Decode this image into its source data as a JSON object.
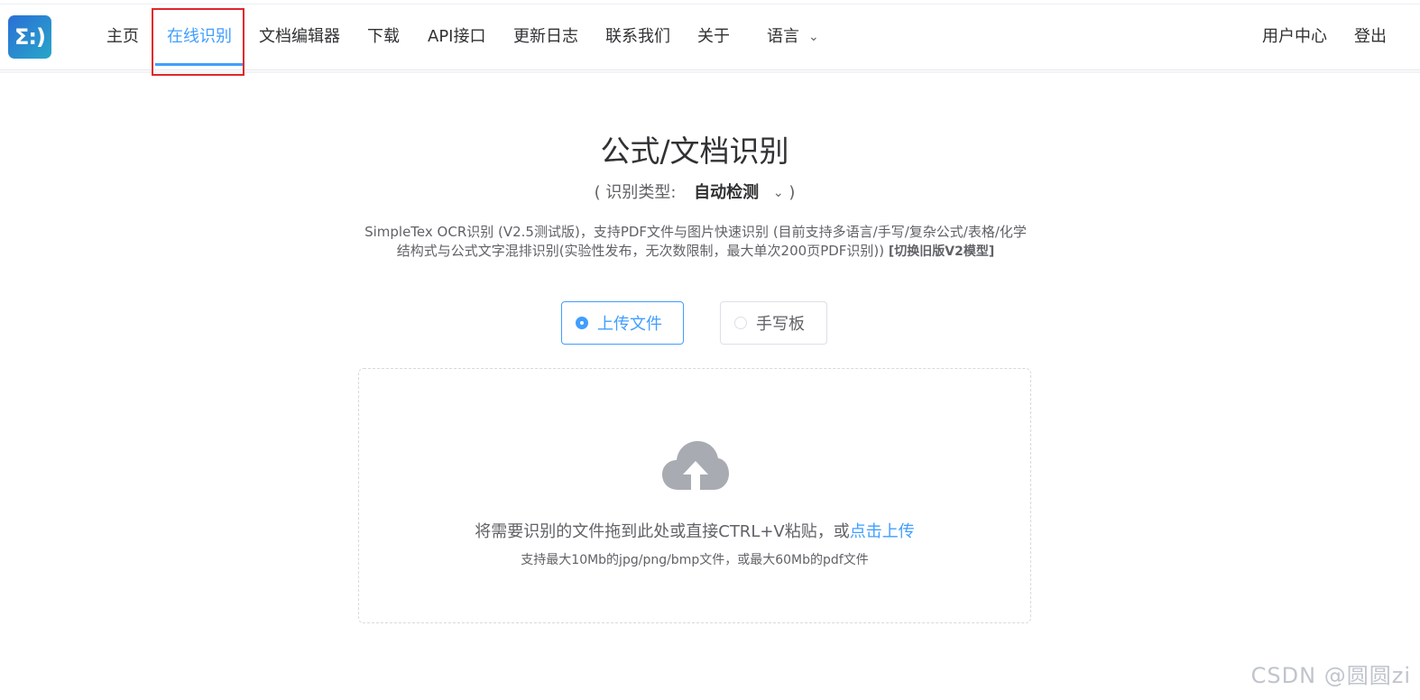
{
  "logo": {
    "glyph": "Σ:)"
  },
  "nav": {
    "items": [
      {
        "label": "主页"
      },
      {
        "label": "在线识别",
        "active": true
      },
      {
        "label": "文档编辑器"
      },
      {
        "label": "下载"
      },
      {
        "label": "API接口"
      },
      {
        "label": "更新日志"
      },
      {
        "label": "联系我们"
      },
      {
        "label": "关于"
      },
      {
        "label": "语言"
      }
    ],
    "user_center": "用户中心",
    "logout": "登出"
  },
  "main": {
    "title": "公式/文档识别",
    "type_prefix": "( 识别类型:",
    "type_value": "自动检测",
    "type_suffix": ")",
    "description": "SimpleTex OCR识别 (V2.5测试版)，支持PDF文件与图片快速识别 (目前支持多语言/手写/复杂公式/表格/化学结构式与公式文字混排识别(实验性发布，无次数限制，最大单次200页PDF识别))",
    "switch_link": "[切换旧版V2模型]",
    "modes": [
      {
        "label": "上传文件",
        "checked": true
      },
      {
        "label": "手写板",
        "checked": false
      }
    ],
    "upload": {
      "icon": "cloud-upload-icon",
      "text": "将需要识别的文件拖到此处或直接CTRL+V粘贴，或",
      "link": "点击上传",
      "tip": "支持最大10Mb的jpg/png/bmp文件，或最大60Mb的pdf文件"
    }
  },
  "watermark": "CSDN @圆圆zi",
  "colors": {
    "accent": "#409eff",
    "highlight": "#e0262b",
    "text": "#303133",
    "muted": "#606266"
  }
}
